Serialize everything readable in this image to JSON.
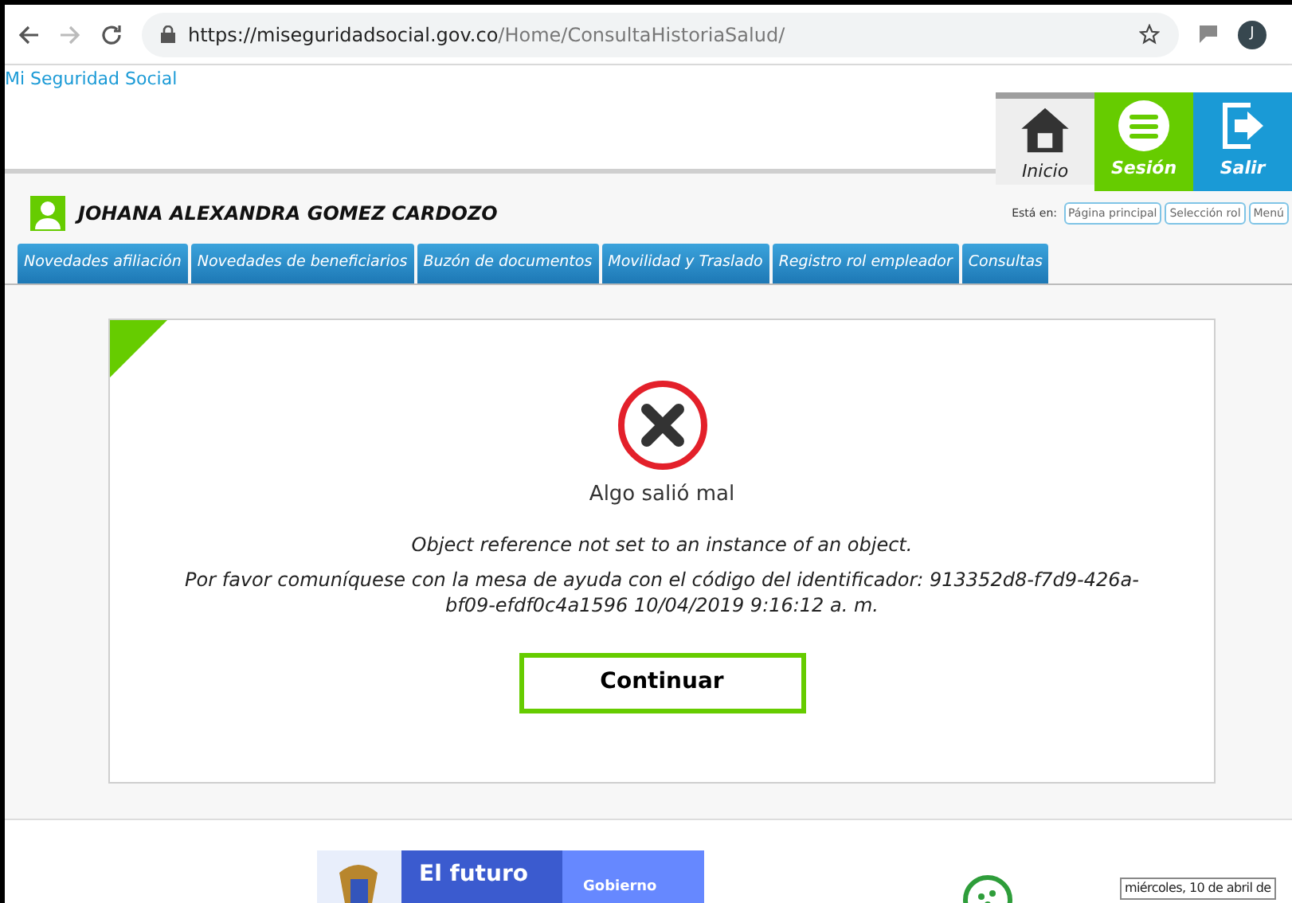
{
  "browser": {
    "url_host": "https://miseguridadsocial.gov.co",
    "url_path": "/Home/ConsultaHistoriaSalud/",
    "profile": "J"
  },
  "site_link": "Mi Seguridad Social",
  "header_buttons": [
    {
      "kind": "home",
      "label": "Inicio"
    },
    {
      "kind": "menu",
      "label": "Sesión"
    },
    {
      "kind": "exit",
      "label": "Salir"
    }
  ],
  "user_name": "JOHANA ALEXANDRA GOMEZ CARDOZO",
  "breadcrumb": {
    "label": "Está en:",
    "links": [
      "Página principal",
      "Selección rol",
      "Menú"
    ]
  },
  "tabs": [
    "Novedades afiliación",
    "Novedades de beneficiarios",
    "Buzón de documentos",
    "Movilidad y Traslado",
    "Registro rol empleador",
    "Consultas"
  ],
  "error": {
    "title": "Algo salió mal",
    "message": "Object reference not set to an instance of an object.",
    "detail": "Por favor comuníquese con la mesa de ayuda con el código del identificador: 913352d8-f7d9-426a-bf09-efdf0c4a1596 10/04/2019 9:16:12 a. m.",
    "button": "Continuar"
  },
  "footer": {
    "banner_text": "El futuro",
    "banner_side": "Gobierno",
    "date": "miércoles, 10 de abril de"
  }
}
